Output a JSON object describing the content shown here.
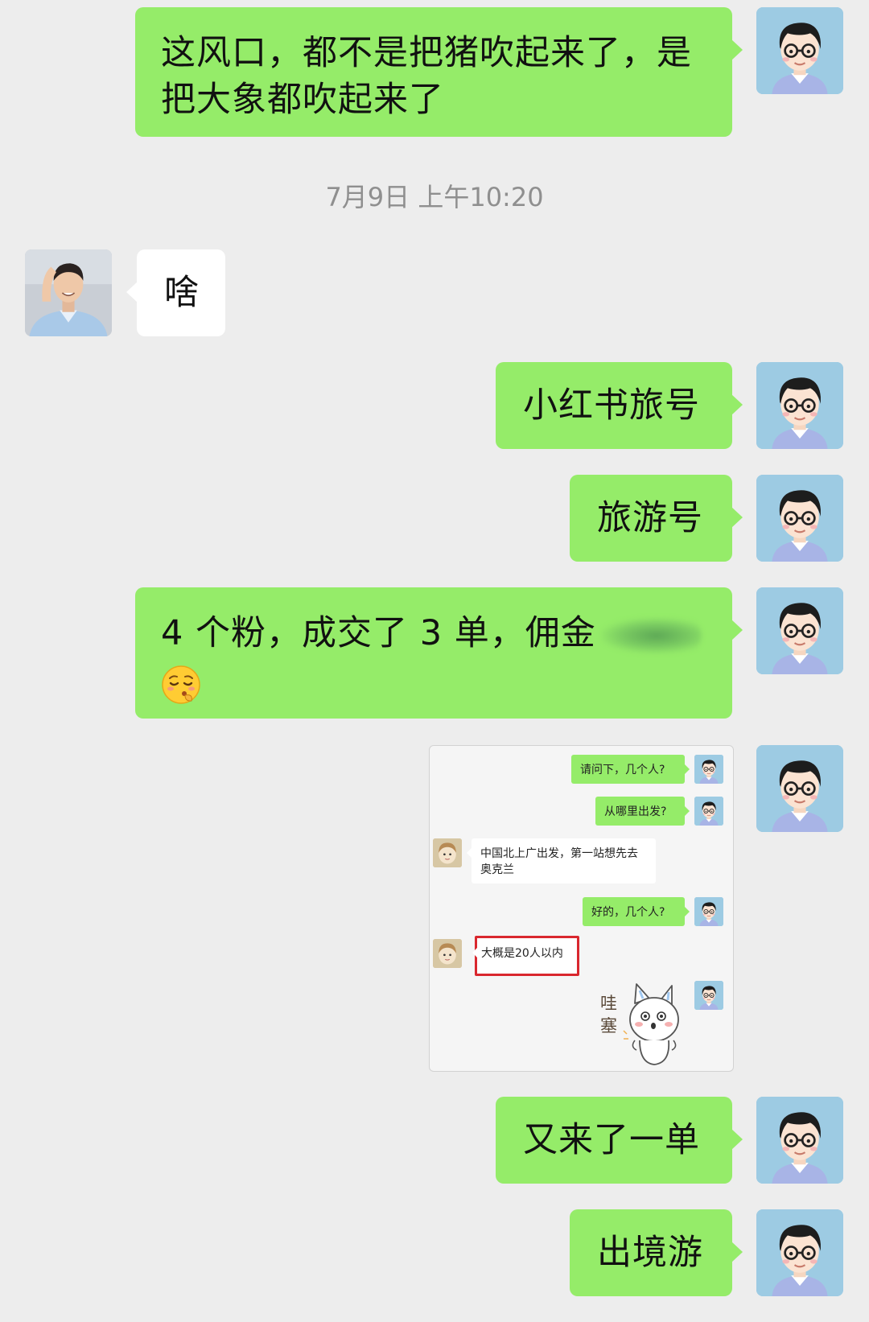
{
  "chat": {
    "msg1": {
      "line1": "这风口，都不是把猪吹起来了，是",
      "line2": "把大象都吹起来了"
    },
    "timestamp": "7月9日 上午10:20",
    "msg2": "啥",
    "msg3": "小红书旅号",
    "msg4": "旅游号",
    "msg5": "4 个粉，成交了 3 单，佣金",
    "msg5_emoji": "relieved-face-emoji",
    "msg6": "又来了一单",
    "msg7": "出境游"
  },
  "screenshot": {
    "m1": "请问下，几个人?",
    "m2": "从哪里出发?",
    "m3_line1": "中国北上广出发，第一站想先去",
    "m3_line2": "奥克兰",
    "m4": "好的，几个人?",
    "m5": "大概是20人以内",
    "sticker_text": {
      "line1": "哇",
      "line2": "塞"
    }
  },
  "colors": {
    "background": "#ededed",
    "outgoing_bubble": "#95ec69",
    "incoming_bubble": "#ffffff",
    "timestamp_text": "#8f8f8f",
    "highlight_border": "#d9272e"
  }
}
